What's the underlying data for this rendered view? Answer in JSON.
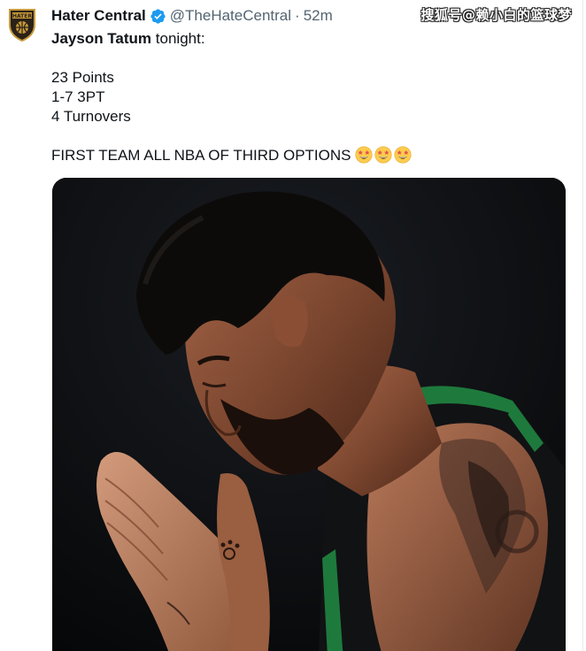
{
  "tweet": {
    "display_name": "Hater Central",
    "handle": "@TheHateCentral",
    "separator": "·",
    "time": "52m",
    "mention": "Jayson Tatum",
    "intro_rest": " tonight:",
    "stats": [
      "23 Points",
      "1-7 3PT",
      "4 Turnovers"
    ],
    "closing": "FIRST TEAM ALL NBA OF THIRD OPTIONS",
    "emojis": [
      "star-struck-emoji",
      "star-struck-emoji",
      "star-struck-emoji"
    ]
  },
  "watermark": {
    "text": "搜狐号@赖小白的篮球梦"
  },
  "icons": {
    "avatar": "hater-central-logo",
    "verified": "verified-badge-icon"
  },
  "colors": {
    "verified_blue": "#1d9bf0",
    "secondary_text": "#536471",
    "primary_text": "#0f1419",
    "jersey_green": "#1e7a3c"
  }
}
